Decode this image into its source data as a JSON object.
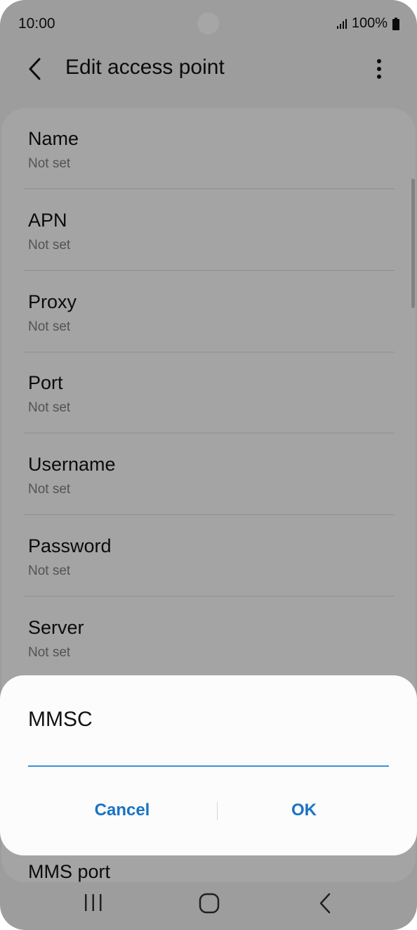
{
  "status": {
    "time": "10:00",
    "battery": "100%"
  },
  "header": {
    "title": "Edit access point"
  },
  "rows": [
    {
      "title": "Name",
      "value": "Not set"
    },
    {
      "title": "APN",
      "value": "Not set"
    },
    {
      "title": "Proxy",
      "value": "Not set"
    },
    {
      "title": "Port",
      "value": "Not set"
    },
    {
      "title": "Username",
      "value": "Not set"
    },
    {
      "title": "Password",
      "value": "Not set"
    },
    {
      "title": "Server",
      "value": "Not set"
    },
    {
      "title": "MMS port",
      "value": ""
    }
  ],
  "dialog": {
    "title": "MMSC",
    "input_value": "",
    "cancel_label": "Cancel",
    "ok_label": "OK"
  },
  "colors": {
    "accent": "#1a72c4",
    "input_underline": "#3e91d6"
  },
  "icons": {
    "back": "chevron-left-icon",
    "more": "more-vertical-icon",
    "nav_recents": "recents-icon",
    "nav_home": "home-icon",
    "nav_back": "nav-back-icon"
  }
}
